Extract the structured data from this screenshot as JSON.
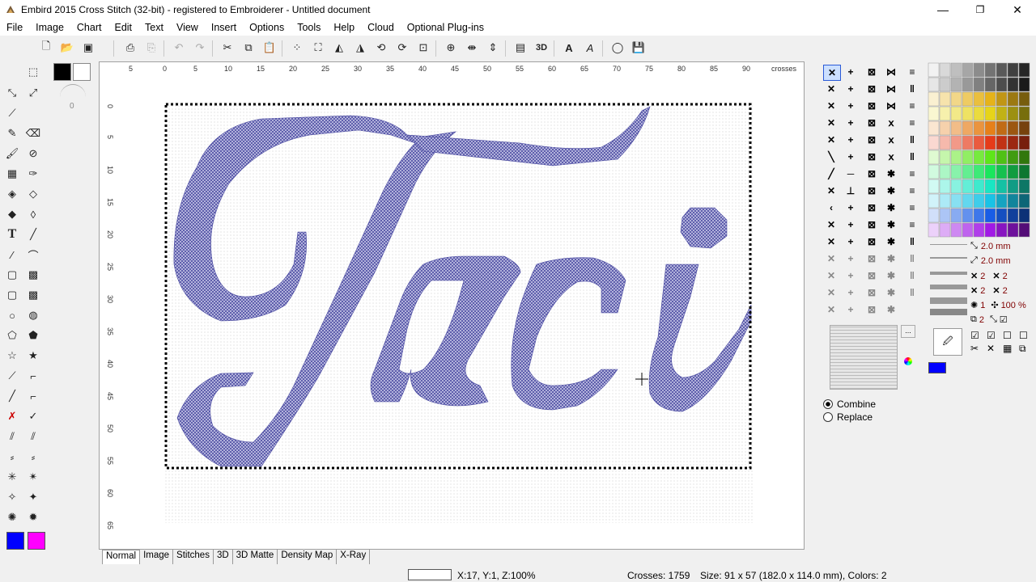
{
  "window": {
    "title": "Embird 2015 Cross Stitch (32-bit) - registered to Embroiderer - Untitled document",
    "minimize": "—",
    "maximize": "❐",
    "close": "✕"
  },
  "menu": [
    "File",
    "Image",
    "Chart",
    "Edit",
    "Text",
    "View",
    "Insert",
    "Options",
    "Tools",
    "Help",
    "Cloud",
    "Optional Plug-ins"
  ],
  "ruler": {
    "top_labels": [
      "5",
      "0",
      "5",
      "10",
      "15",
      "20",
      "25",
      "30",
      "35",
      "40",
      "45",
      "50",
      "55",
      "60",
      "65",
      "70",
      "75",
      "80",
      "85",
      "90"
    ],
    "unit": "crosses",
    "left_labels": [
      "0",
      "5",
      "10",
      "15",
      "20",
      "25",
      "30",
      "35",
      "40",
      "45",
      "50",
      "55",
      "60",
      "65"
    ]
  },
  "line_panel": {
    "width1": "2.0 mm",
    "width2": "2.0 mm",
    "count_a": "2",
    "count_b": "2",
    "count_c": "2",
    "count_d": "2",
    "count_e": "1",
    "zoom": "100 %",
    "layers": "2"
  },
  "colors": {
    "primary": "#0000ff",
    "secondary": "#ff00ff",
    "fg_swatch": "#000000",
    "bg_swatch": "#ffffff",
    "selected_thread": "#0000ff"
  },
  "mode": {
    "combine": "Combine",
    "replace": "Replace",
    "selected": "combine"
  },
  "left_panel": {
    "counter": "0"
  },
  "tabs": [
    "Normal",
    "Image",
    "Stitches",
    "3D",
    "3D Matte",
    "Density Map",
    "X-Ray"
  ],
  "active_tab": "Normal",
  "status": {
    "coords": "X:17, Y:1, Z:100%",
    "crosses": "Crosses: 1759",
    "size": "Size: 91 x 57 (182.0 x 114.0 mm), Colors: 2"
  }
}
